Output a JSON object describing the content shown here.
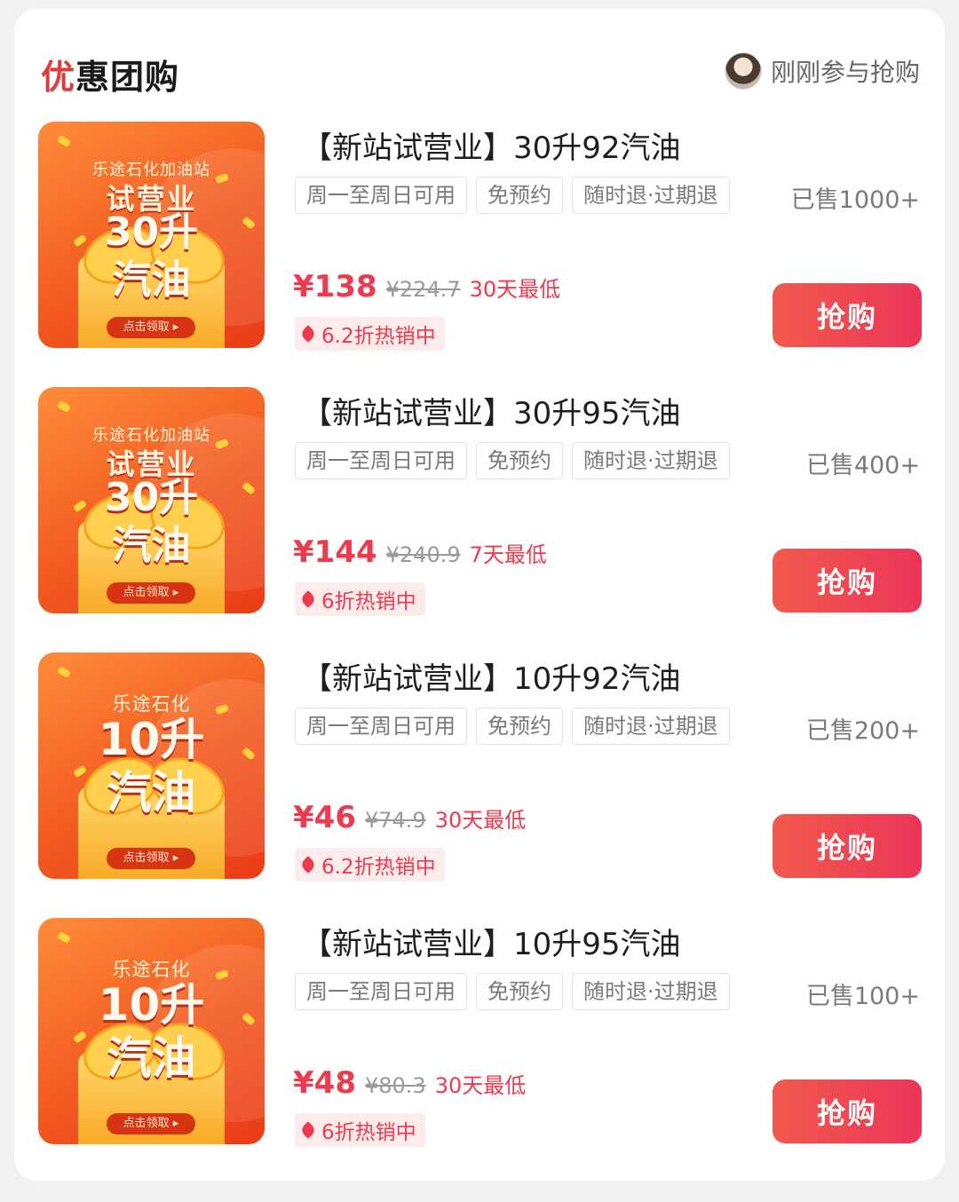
{
  "header": {
    "title_first": "优",
    "title_rest": "惠团购",
    "right_text": "刚刚参与抢购"
  },
  "items": [
    {
      "thumb": {
        "shop": "乐途石化加油站",
        "line1": "试营业",
        "line2": "30升",
        "line3": "汽油",
        "pill": "点击领取 ▸"
      },
      "title": "【新站试营业】30升92汽油",
      "tags": [
        "周一至周日可用",
        "免预约",
        "随时退·过期退"
      ],
      "sold": "已售1000+",
      "price": "¥138",
      "original": "¥224.7",
      "lowest": "30天最低",
      "discount": "6.2折热销中",
      "button": "抢购"
    },
    {
      "thumb": {
        "shop": "乐途石化加油站",
        "line1": "试营业",
        "line2": "30升",
        "line3": "汽油",
        "pill": "点击领取 ▸"
      },
      "title": "【新站试营业】30升95汽油",
      "tags": [
        "周一至周日可用",
        "免预约",
        "随时退·过期退"
      ],
      "sold": "已售400+",
      "price": "¥144",
      "original": "¥240.9",
      "lowest": "7天最低",
      "discount": "6折热销中",
      "button": "抢购"
    },
    {
      "thumb": {
        "shop": "乐途石化",
        "line1": "",
        "line2": "10升",
        "line3": "汽油",
        "pill": "点击领取 ▸"
      },
      "title": "【新站试营业】10升92汽油",
      "tags": [
        "周一至周日可用",
        "免预约",
        "随时退·过期退"
      ],
      "sold": "已售200+",
      "price": "¥46",
      "original": "¥74.9",
      "lowest": "30天最低",
      "discount": "6.2折热销中",
      "button": "抢购"
    },
    {
      "thumb": {
        "shop": "乐途石化",
        "line1": "",
        "line2": "10升",
        "line3": "汽油",
        "pill": "点击领取 ▸"
      },
      "title": "【新站试营业】10升95汽油",
      "tags": [
        "周一至周日可用",
        "免预约",
        "随时退·过期退"
      ],
      "sold": "已售100+",
      "price": "¥48",
      "original": "¥80.3",
      "lowest": "30天最低",
      "discount": "6折热销中",
      "button": "抢购"
    }
  ]
}
